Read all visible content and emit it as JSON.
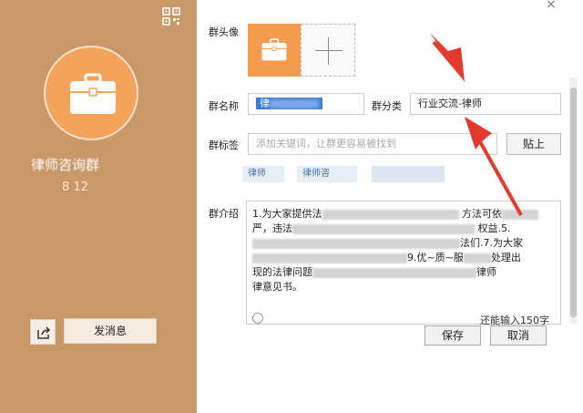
{
  "left_panel": {
    "group_name": "律师咨询群",
    "group_id": "8 12",
    "send_label": "发消息"
  },
  "form": {
    "avatar_label": "群头像",
    "name_label": "群名称",
    "name_value": "律",
    "category_label": "群分类",
    "category_value": "行业交流-律师",
    "tag_label": "群标签",
    "tag_placeholder": "添加关键词，让群更容易被找到",
    "paste_label": "贴上",
    "tags": [
      "律师",
      "律师咨",
      ""
    ],
    "intro_label": "群介绍",
    "intro_lines": [
      "1.为大家提供法",
      "严，违法",
      "",
      "现的法律问题",
      "律意见书。"
    ],
    "intro_fragments": [
      "方法可依",
      "权益.5.",
      "法们.7.为大家",
      "9.优~质~服",
      "处理出",
      "律师"
    ],
    "counter": "还能输入150字",
    "save_label": "保存",
    "cancel_label": "取消"
  },
  "colors": {
    "left_panel_bg": "#c99868",
    "avatar_orange": "#f4a35a",
    "selection_blue": "#3b7bd8",
    "arrow_red": "#e23a2c"
  },
  "icons": [
    "qr-code-icon",
    "briefcase-icon",
    "share-icon",
    "add-icon",
    "close-icon",
    "emoji-icon"
  ]
}
